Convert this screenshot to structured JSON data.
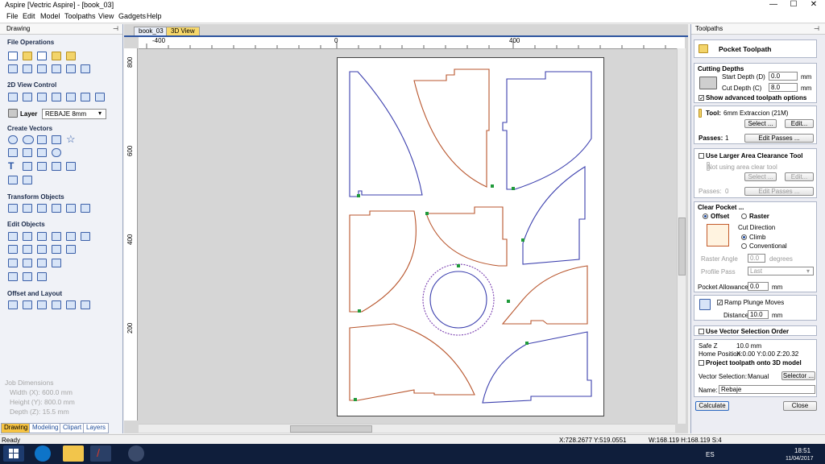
{
  "window": {
    "title": "Aspire [Vectric Aspire] - [book_03]",
    "min": "—",
    "max": "☐",
    "close": "✕"
  },
  "menu": [
    "File",
    "Edit",
    "Model",
    "Toolpaths",
    "View",
    "Gadgets",
    "Help"
  ],
  "left": {
    "header": "Drawing",
    "pin": "⊣",
    "sections": {
      "file_ops": "File Operations",
      "view2d": "2D View Control",
      "create_vectors": "Create Vectors",
      "transform": "Transform Objects",
      "edit_objects": "Edit Objects",
      "offset_layout": "Offset and Layout"
    },
    "layer_label": "Layer",
    "layer_value": "REBAJE 8mm",
    "job": {
      "title": "Job Dimensions",
      "width": "Width  (X): 600.0 mm",
      "height": "Height (Y): 800.0 mm",
      "depth": "Depth  (Z): 15.5 mm"
    },
    "tabs": [
      "Drawing",
      "Modeling",
      "Clipart",
      "Layers"
    ]
  },
  "view": {
    "tabs": [
      "book_03",
      "3D View"
    ],
    "ruler_h": [
      "-400",
      "0",
      "400"
    ],
    "ruler_v": [
      "800",
      "600",
      "400",
      "200"
    ]
  },
  "right": {
    "header": "Toolpaths",
    "pin": "⊣",
    "title": "Pocket Toolpath",
    "cutting_depths": "Cutting Depths",
    "start_depth_label": "Start Depth (D)",
    "start_depth": "0.0",
    "unit_mm": "mm",
    "cut_depth_label": "Cut Depth (C)",
    "cut_depth": "8.0",
    "show_advanced": "Show advanced toolpath options",
    "tool_label": "Tool:",
    "tool_value": "6mm Extraccion (21M)",
    "select_btn": "Select ...",
    "edit_btn": "Edit...",
    "passes_label": "Passes:",
    "passes_value": "1",
    "edit_passes_btn": "Edit Passes ...",
    "larger_area": "Use Larger Area Clearance Tool",
    "not_using": "Not using area clear tool",
    "select_btn2": "Select ...",
    "edit_btn2": "Edit...",
    "passes_value2": "0",
    "edit_passes_btn2": "Edit Passes ...",
    "clear_pocket": "Clear Pocket ...",
    "offset": "Offset",
    "raster": "Raster",
    "cut_direction": "Cut Direction",
    "climb": "Climb",
    "conventional": "Conventional",
    "raster_angle_label": "Raster Angle",
    "raster_angle": "0.0",
    "degrees": "degrees",
    "profile_pass_label": "Profile Pass",
    "profile_pass": "Last",
    "pocket_allowance_label": "Pocket Allowance",
    "pocket_allowance": "0.0",
    "ramp": "Ramp Plunge Moves",
    "distance_label": "Distance",
    "distance": "10.0",
    "vector_order": "Use Vector Selection Order",
    "safe_z": "Safe Z",
    "safe_z_value": "10.0 mm",
    "home_label": "Home Position",
    "home_value": "X:0.00 Y:0.00 Z:20.32",
    "project": "Project toolpath onto 3D model",
    "vector_sel_label": "Vector Selection:",
    "vector_sel_value": "Manual",
    "selector_btn": "Selector ...",
    "name_label": "Name:",
    "name_value": "Rebaje",
    "calculate": "Calculate",
    "close": "Close"
  },
  "status": {
    "ready": "Ready",
    "coords": "X:728.2677 Y:519.0551",
    "dims": "W:168.119  H:168.119  S:4"
  },
  "taskbar": {
    "lang": "ES",
    "time": "18:51",
    "date": "11/04/2017"
  },
  "colors": {
    "accent": "#3a5fa8",
    "taskbar": "#0f1e3b",
    "path_blue": "#3b3fae",
    "path_orange": "#b8552c"
  }
}
